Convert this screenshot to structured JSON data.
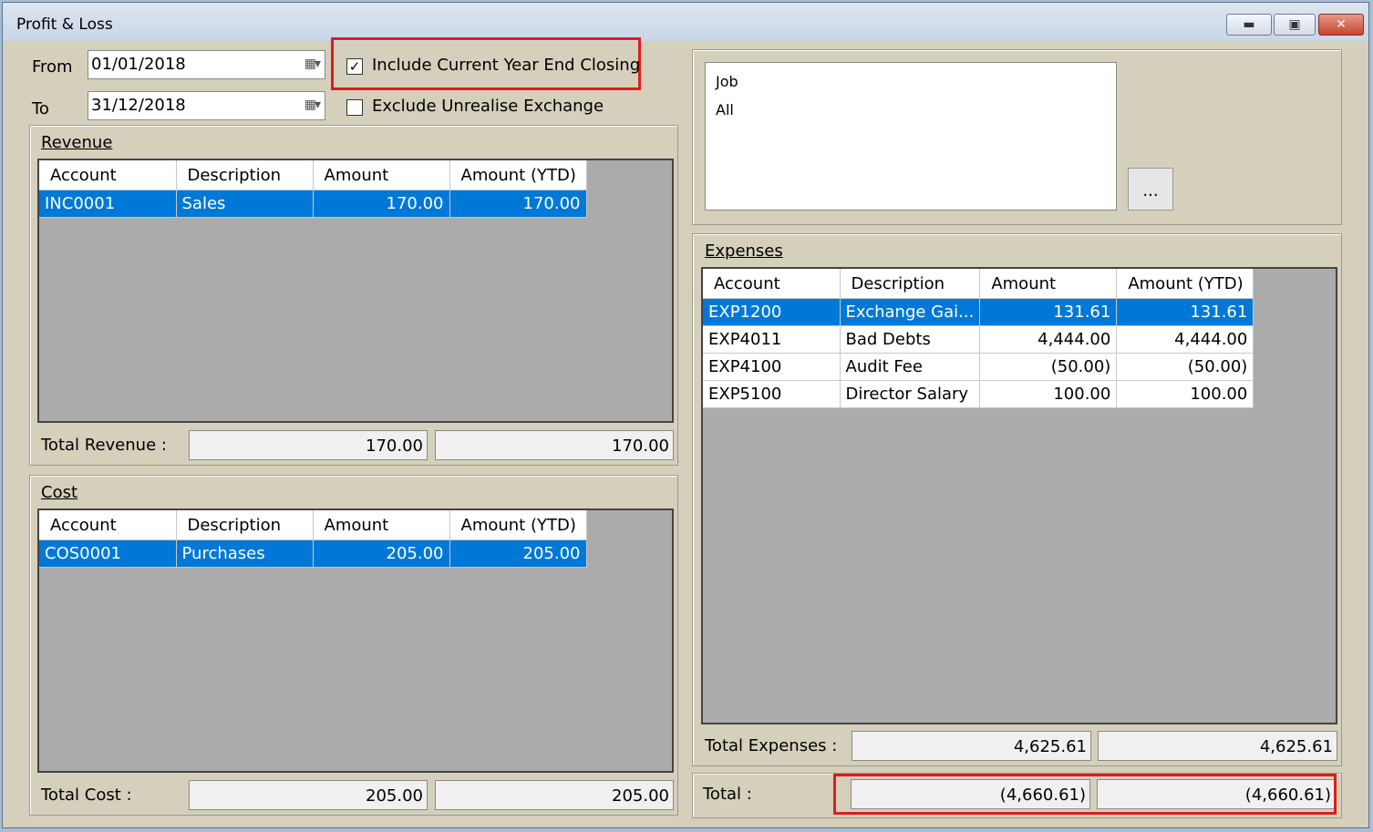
{
  "window": {
    "title": "Profit & Loss"
  },
  "filters": {
    "from_label": "From",
    "from_value": "01/01/2018",
    "to_label": "To",
    "to_value": "31/12/2018",
    "include_closing_label": "Include Current Year End Closing",
    "include_closing_checked": true,
    "exclude_unrealise_label": "Exclude Unrealise Exchange",
    "exclude_unrealise_checked": false
  },
  "columns": [
    "Account",
    "Description",
    "Amount",
    "Amount (YTD)"
  ],
  "revenue": {
    "title": "Revenue",
    "rows": [
      {
        "account": "INC0001",
        "description": "Sales",
        "amount": "170.00",
        "ytd": "170.00"
      }
    ],
    "total_label": "Total Revenue :",
    "total": "170.00",
    "total_ytd": "170.00"
  },
  "cost": {
    "title": "Cost",
    "rows": [
      {
        "account": "COS0001",
        "description": "Purchases",
        "amount": "205.00",
        "ytd": "205.00"
      }
    ],
    "total_label": "Total Cost :",
    "total": "205.00",
    "total_ytd": "205.00"
  },
  "job": {
    "header": "Job",
    "value": "All",
    "button_label": "..."
  },
  "expenses": {
    "title": "Expenses",
    "rows": [
      {
        "account": "EXP1200",
        "description": "Exchange Gai...",
        "amount": "131.61",
        "ytd": "131.61"
      },
      {
        "account": "EXP4011",
        "description": "Bad Debts",
        "amount": "4,444.00",
        "ytd": "4,444.00"
      },
      {
        "account": "EXP4100",
        "description": "Audit Fee",
        "amount": "(50.00)",
        "ytd": "(50.00)"
      },
      {
        "account": "EXP5100",
        "description": "Director Salary",
        "amount": "100.00",
        "ytd": "100.00"
      }
    ],
    "total_label": "Total Expenses :",
    "total": "4,625.61",
    "total_ytd": "4,625.61"
  },
  "grand_total": {
    "label": "Total :",
    "value": "(4,660.61)",
    "value_ytd": "(4,660.61)"
  }
}
